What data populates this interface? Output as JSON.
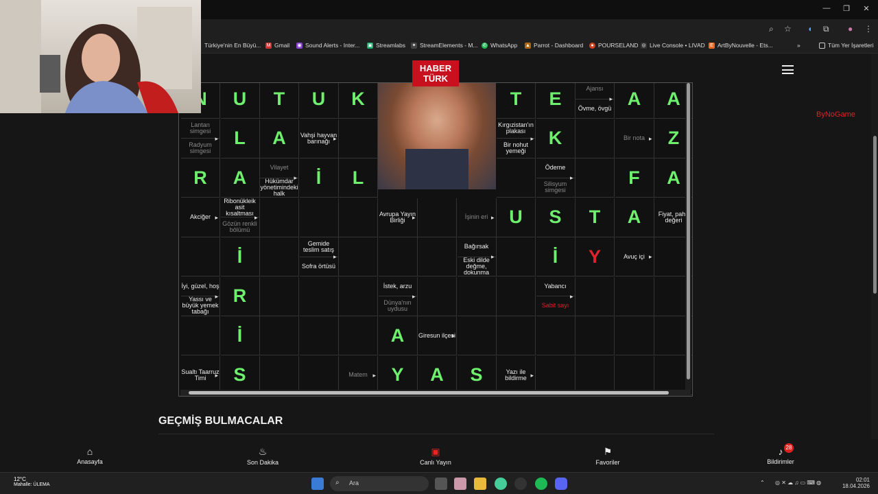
{
  "browser": {
    "bookmarks": [
      "Türkiye'nin En Büyü...",
      "Gmail",
      "Sound Alerts - Inter...",
      "Streamlabs",
      "StreamElements - M...",
      "WhatsApp",
      "Parrot - Dashboard",
      "POURSELAND",
      "Live Console • LIVAD",
      "ArtByNouvelle - Ets..."
    ],
    "all_bookmarks": "Tüm Yer İşaretleri"
  },
  "logo": {
    "line1": "HABER",
    "line2": "TÜRK"
  },
  "watermark": "ByNoGame",
  "puzzle": {
    "cells": [
      {
        "r": 0,
        "c": 0,
        "letter": "N"
      },
      {
        "r": 0,
        "c": 1,
        "letter": "U"
      },
      {
        "r": 0,
        "c": 2,
        "letter": "T"
      },
      {
        "r": 0,
        "c": 3,
        "letter": "U"
      },
      {
        "r": 0,
        "c": 4,
        "letter": "K"
      },
      {
        "r": 0,
        "c": 8,
        "letter": "T"
      },
      {
        "r": 0,
        "c": 9,
        "letter": "E"
      },
      {
        "r": 0,
        "c": 10,
        "clues": [
          "Ajansı",
          "Övme, övgü"
        ]
      },
      {
        "r": 0,
        "c": 11,
        "letter": "A"
      },
      {
        "r": 0,
        "c": 12,
        "letter": "A"
      },
      {
        "r": 1,
        "c": 0,
        "clues": [
          "Lantan simgesi",
          "Radyum simgesi"
        ],
        "dim": true
      },
      {
        "r": 1,
        "c": 1,
        "letter": "L"
      },
      {
        "r": 1,
        "c": 2,
        "letter": "A"
      },
      {
        "r": 1,
        "c": 3,
        "clues": [
          "Vahşi hayvan barınağı"
        ]
      },
      {
        "r": 1,
        "c": 4
      },
      {
        "r": 1,
        "c": 8,
        "clues": [
          "Kırgızistan'ın plakası",
          "Bir nohut yemeği"
        ]
      },
      {
        "r": 1,
        "c": 9,
        "letter": "K"
      },
      {
        "r": 1,
        "c": 10
      },
      {
        "r": 1,
        "c": 11,
        "clues": [
          "Bir nota"
        ],
        "dim": true
      },
      {
        "r": 1,
        "c": 12,
        "letter": "Z"
      },
      {
        "r": 2,
        "c": 0,
        "letter": "R"
      },
      {
        "r": 2,
        "c": 1,
        "letter": "A"
      },
      {
        "r": 2,
        "c": 2,
        "clues": [
          "Vilayet",
          "Hükümdar yönetimindeki halk"
        ]
      },
      {
        "r": 2,
        "c": 3,
        "letter": "İ"
      },
      {
        "r": 2,
        "c": 4,
        "letter": "L"
      },
      {
        "r": 2,
        "c": 8
      },
      {
        "r": 2,
        "c": 9,
        "clues": [
          "Ödeme",
          "Silisyum simgesi"
        ]
      },
      {
        "r": 2,
        "c": 10
      },
      {
        "r": 2,
        "c": 11,
        "letter": "F"
      },
      {
        "r": 2,
        "c": 12,
        "letter": "A"
      },
      {
        "r": 3,
        "c": 0,
        "clues": [
          "Akciğer"
        ]
      },
      {
        "r": 3,
        "c": 1,
        "clues": [
          "Ribonükleik asit kısaltması",
          "Gözün renkli bölümü"
        ]
      },
      {
        "r": 3,
        "c": 2
      },
      {
        "r": 3,
        "c": 3
      },
      {
        "r": 3,
        "c": 4
      },
      {
        "r": 3,
        "c": 5,
        "clues": [
          "Avrupa Yayın Birliği"
        ]
      },
      {
        "r": 3,
        "c": 6
      },
      {
        "r": 3,
        "c": 7,
        "clues": [
          "İşinin eri"
        ],
        "dim": true
      },
      {
        "r": 3,
        "c": 8,
        "letter": "U"
      },
      {
        "r": 3,
        "c": 9,
        "letter": "S"
      },
      {
        "r": 3,
        "c": 10,
        "letter": "T"
      },
      {
        "r": 3,
        "c": 11,
        "letter": "A"
      },
      {
        "r": 3,
        "c": 12,
        "clues": [
          "Fiyat, paha değeri"
        ]
      },
      {
        "r": 4,
        "c": 0
      },
      {
        "r": 4,
        "c": 1,
        "letter": "İ"
      },
      {
        "r": 4,
        "c": 2
      },
      {
        "r": 4,
        "c": 3,
        "clues": [
          "Gemide teslim satış",
          "Sofra örtüsü"
        ]
      },
      {
        "r": 4,
        "c": 4
      },
      {
        "r": 4,
        "c": 5
      },
      {
        "r": 4,
        "c": 6
      },
      {
        "r": 4,
        "c": 7,
        "clues": [
          "Bağırsak",
          "Eski dilde değme, dokunma"
        ]
      },
      {
        "r": 4,
        "c": 8
      },
      {
        "r": 4,
        "c": 9,
        "letter": "İ"
      },
      {
        "r": 4,
        "c": 10,
        "letter": "Y",
        "red": true
      },
      {
        "r": 4,
        "c": 11,
        "clues": [
          "Avuç içi"
        ]
      },
      {
        "r": 4,
        "c": 12
      },
      {
        "r": 5,
        "c": 0,
        "clues": [
          "İyi, güzel, hoş",
          "Yassı ve büyük yemek tabağı"
        ]
      },
      {
        "r": 5,
        "c": 1,
        "letter": "R"
      },
      {
        "r": 5,
        "c": 2
      },
      {
        "r": 5,
        "c": 3
      },
      {
        "r": 5,
        "c": 4
      },
      {
        "r": 5,
        "c": 5,
        "clues": [
          "İstek, arzu",
          "Dünya'nın uydusu"
        ]
      },
      {
        "r": 5,
        "c": 6
      },
      {
        "r": 5,
        "c": 7
      },
      {
        "r": 5,
        "c": 8
      },
      {
        "r": 5,
        "c": 9,
        "clues": [
          "Yabancı",
          "Sabit sayı"
        ]
      },
      {
        "r": 5,
        "c": 10
      },
      {
        "r": 5,
        "c": 11
      },
      {
        "r": 5,
        "c": 12
      },
      {
        "r": 6,
        "c": 0
      },
      {
        "r": 6,
        "c": 1,
        "letter": "İ"
      },
      {
        "r": 6,
        "c": 2
      },
      {
        "r": 6,
        "c": 3
      },
      {
        "r": 6,
        "c": 4
      },
      {
        "r": 6,
        "c": 5,
        "letter": "A"
      },
      {
        "r": 6,
        "c": 6,
        "clues": [
          "Giresun ilçesi"
        ]
      },
      {
        "r": 6,
        "c": 7
      },
      {
        "r": 6,
        "c": 8
      },
      {
        "r": 6,
        "c": 9
      },
      {
        "r": 6,
        "c": 10
      },
      {
        "r": 6,
        "c": 11
      },
      {
        "r": 6,
        "c": 12
      },
      {
        "r": 7,
        "c": 0,
        "clues": [
          "Sualtı Taarruz Timi"
        ]
      },
      {
        "r": 7,
        "c": 1,
        "letter": "S"
      },
      {
        "r": 7,
        "c": 2
      },
      {
        "r": 7,
        "c": 3
      },
      {
        "r": 7,
        "c": 4,
        "clues": [
          "Matem"
        ],
        "dim": true
      },
      {
        "r": 7,
        "c": 5,
        "letter": "Y"
      },
      {
        "r": 7,
        "c": 6,
        "letter": "A"
      },
      {
        "r": 7,
        "c": 7,
        "letter": "S"
      },
      {
        "r": 7,
        "c": 8,
        "clues": [
          "Yazı ile bildirme"
        ]
      },
      {
        "r": 7,
        "c": 9
      },
      {
        "r": 7,
        "c": 10
      },
      {
        "r": 7,
        "c": 11
      },
      {
        "r": 7,
        "c": 12
      }
    ]
  },
  "section_title": "GEÇMİŞ BULMACALAR",
  "bottom_nav": [
    {
      "label": "Anasayfa",
      "icon": "home-icon"
    },
    {
      "label": "Son Dakika",
      "icon": "flame-icon"
    },
    {
      "label": "Canlı Yayın",
      "icon": "tv-icon"
    },
    {
      "label": "Favoriler",
      "icon": "bookmark-icon"
    },
    {
      "label": "Bildirimler",
      "icon": "bell-icon"
    }
  ],
  "notification_count": "28",
  "taskbar": {
    "weather_temp": "12°C",
    "weather_text": "Mahalle: ÜLEMA",
    "search_placeholder": "Ara",
    "time": "02:01",
    "date": "18.04.2026"
  }
}
